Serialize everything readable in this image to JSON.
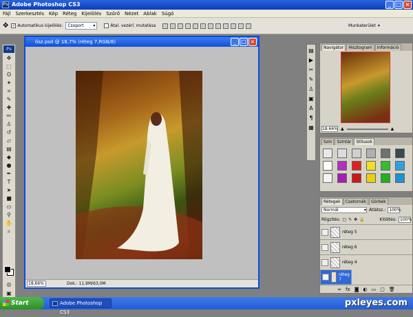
{
  "app": {
    "title": "Adobe Photoshop CS3",
    "logo": "Ps"
  },
  "menu": [
    "Fájl",
    "Szerkesztés",
    "Kép",
    "Réteg",
    "Kijelölés",
    "Szűrő",
    "Nézet",
    "Ablak",
    "Súgó"
  ],
  "options": {
    "auto_select_label": "Automatikus kijelölés:",
    "auto_select_checked": "✓",
    "group_value": "Csoport",
    "transform_label": "Átal. vezérl. mutatása",
    "workspace_label": "Munkaterület"
  },
  "document": {
    "title": "ösz.psd @ 18,7% (réteg 7,RGB/8)",
    "zoom": "18,66%",
    "info": "Dok.: 11,9M/63,0M"
  },
  "navigator": {
    "tabs": [
      "Navigátor",
      "Hisztogram",
      "Információ"
    ],
    "zoom": "18.66%"
  },
  "styles": {
    "tabs": [
      "Szín",
      "Színtár",
      "Stílusok"
    ]
  },
  "layers": {
    "tabs": [
      "Rétegek",
      "Csatornák",
      "Görbék"
    ],
    "blend_mode": "Normál",
    "opacity_label": "Átlátsz.:",
    "opacity_value": "100%",
    "lock_label": "Rögzítés:",
    "fill_label": "Kitöltés:",
    "fill_value": "100%",
    "items": [
      {
        "name": "réteg 5",
        "visible": ""
      },
      {
        "name": "réteg 6",
        "visible": ""
      },
      {
        "name": "réteg 4",
        "visible": ""
      },
      {
        "name": "réteg 7",
        "visible": "👁"
      }
    ]
  },
  "taskbar": {
    "start": "Start",
    "item": "Adobe Photoshop CS3"
  },
  "watermark": "pxleyes.com",
  "colors": {
    "titlebar": "#0a3fb8",
    "selected_layer": "#2f68d8",
    "taskbar": "#245dd6",
    "start": "#2f8e2b"
  }
}
